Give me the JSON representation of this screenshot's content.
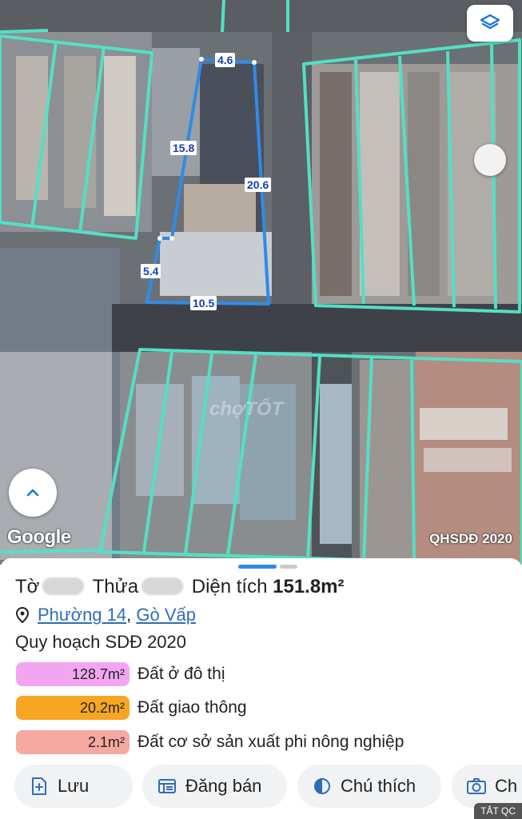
{
  "map": {
    "segment_labels": [
      "4.6",
      "15.8",
      "20.6",
      "5.4",
      "10.5"
    ],
    "google_label": "Google",
    "map_tag": "QHSDĐ 2020",
    "watermark": "chợTỐT",
    "icons": {
      "layers": "layers-icon",
      "expand": "chevron-up-icon"
    },
    "colors": {
      "parcel": "#52e0c4",
      "selected_parcel": "#2f8be8"
    }
  },
  "sheet": {
    "to_label": "Tờ",
    "thua_label": "Thửa",
    "area_label": "Diện tích",
    "area_value": "151.8m²",
    "ward": "Phường 14",
    "separator": ",",
    "district": "Gò Vấp",
    "plan_title": "Quy hoạch SDĐ 2020",
    "legend": [
      {
        "value": "128.7m²",
        "label": "Đất ở đô thị",
        "color": "#f2a6f2"
      },
      {
        "value": "20.2m²",
        "label": "Đất giao thông",
        "color": "#f6a623"
      },
      {
        "value": "2.1m²",
        "label": "Đất cơ sở sản xuất phi nông nghiệp",
        "color": "#f7a8a0"
      }
    ],
    "actions": [
      {
        "label": "Lưu",
        "icon": "plus-square-icon"
      },
      {
        "label": "Đăng bán",
        "icon": "listing-icon"
      },
      {
        "label": "Chú thích",
        "icon": "half-circle-icon"
      },
      {
        "label": "Ch",
        "icon": "camera-icon"
      }
    ],
    "ad_toggle": "TẮT QC"
  }
}
